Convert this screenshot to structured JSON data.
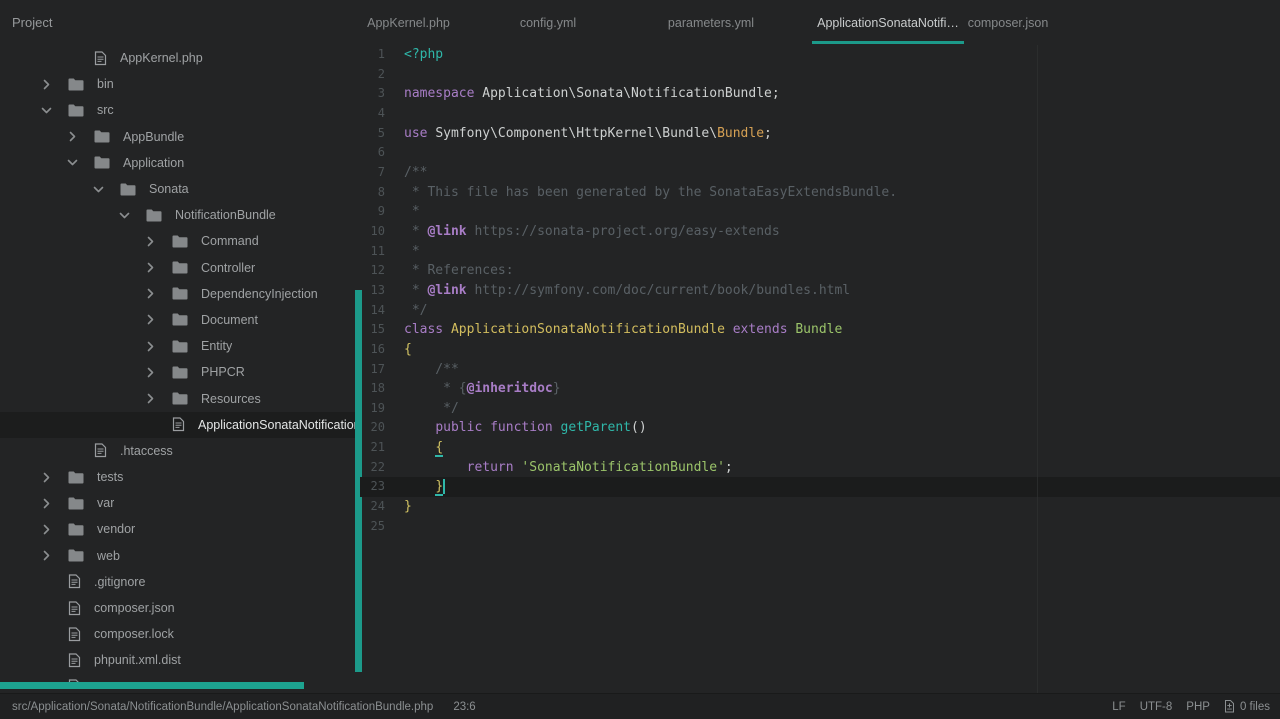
{
  "accent_color": "#1c9a8a",
  "sidebar": {
    "title": "Project"
  },
  "tabs": [
    {
      "label": "AppKernel.php",
      "active": false
    },
    {
      "label": "config.yml",
      "active": false
    },
    {
      "label": "parameters.yml",
      "active": false
    },
    {
      "label": "ApplicationSonataNotifi…",
      "active": true
    },
    {
      "label": "composer.json",
      "active": false
    }
  ],
  "tree": {
    "items": [
      {
        "kind": "file",
        "level": 1,
        "label": "AppKernel.php"
      },
      {
        "kind": "folder",
        "level": 0,
        "expanded": false,
        "label": "bin"
      },
      {
        "kind": "folder",
        "level": 0,
        "expanded": true,
        "label": "src"
      },
      {
        "kind": "folder",
        "level": 1,
        "expanded": false,
        "label": "AppBundle"
      },
      {
        "kind": "folder",
        "level": 1,
        "expanded": true,
        "label": "Application"
      },
      {
        "kind": "folder",
        "level": 2,
        "expanded": true,
        "label": "Sonata"
      },
      {
        "kind": "folder",
        "level": 3,
        "expanded": true,
        "label": "NotificationBundle"
      },
      {
        "kind": "folder",
        "level": 4,
        "expanded": false,
        "label": "Command"
      },
      {
        "kind": "folder",
        "level": 4,
        "expanded": false,
        "label": "Controller"
      },
      {
        "kind": "folder",
        "level": 4,
        "expanded": false,
        "label": "DependencyInjection"
      },
      {
        "kind": "folder",
        "level": 4,
        "expanded": false,
        "label": "Document"
      },
      {
        "kind": "folder",
        "level": 4,
        "expanded": false,
        "label": "Entity"
      },
      {
        "kind": "folder",
        "level": 4,
        "expanded": false,
        "label": "PHPCR"
      },
      {
        "kind": "folder",
        "level": 4,
        "expanded": false,
        "label": "Resources"
      },
      {
        "kind": "file",
        "level": 4,
        "label": "ApplicationSonataNotificationB",
        "selected": true
      },
      {
        "kind": "file",
        "level": 1,
        "label": ".htaccess"
      },
      {
        "kind": "folder",
        "level": 0,
        "expanded": false,
        "label": "tests"
      },
      {
        "kind": "folder",
        "level": 0,
        "expanded": false,
        "label": "var"
      },
      {
        "kind": "folder",
        "level": 0,
        "expanded": false,
        "label": "vendor"
      },
      {
        "kind": "folder",
        "level": 0,
        "expanded": false,
        "label": "web"
      },
      {
        "kind": "file",
        "level": 0,
        "label": ".gitignore"
      },
      {
        "kind": "file",
        "level": 0,
        "label": "composer.json"
      },
      {
        "kind": "file",
        "level": 0,
        "label": "composer.lock"
      },
      {
        "kind": "file",
        "level": 0,
        "label": "phpunit.xml.dist"
      },
      {
        "kind": "file",
        "level": 0,
        "label": ""
      }
    ]
  },
  "editor": {
    "cursor": {
      "line": 23,
      "col": 6
    },
    "syntax_colors": {
      "keyword": "#a87dc6",
      "php_tag": "#2fb7a9",
      "class_name": "#d2bd5e",
      "imported_class": "#d6a154",
      "string": "#9bc46a",
      "comment": "#596065",
      "doc_tag": "#a87dc6",
      "brace": "#d2c363",
      "default": "#cdd0d0"
    },
    "lines": [
      {
        "n": 1,
        "tokens": [
          [
            "t",
            "<?php"
          ]
        ]
      },
      {
        "n": 2,
        "tokens": []
      },
      {
        "n": 3,
        "tokens": [
          [
            "k",
            "namespace "
          ],
          [
            "d",
            "Application\\Sonata\\NotificationBundle;"
          ]
        ]
      },
      {
        "n": 4,
        "tokens": []
      },
      {
        "n": 5,
        "tokens": [
          [
            "k",
            "use "
          ],
          [
            "d",
            "Symfony\\Component\\HttpKernel\\Bundle\\"
          ],
          [
            "o",
            "Bundle"
          ],
          [
            "d",
            ";"
          ]
        ]
      },
      {
        "n": 6,
        "tokens": []
      },
      {
        "n": 7,
        "tokens": [
          [
            "c",
            "/**"
          ]
        ]
      },
      {
        "n": 8,
        "tokens": [
          [
            "c",
            " * This file has been generated by the SonataEasyExtendsBundle."
          ]
        ]
      },
      {
        "n": 9,
        "tokens": [
          [
            "c",
            " *"
          ]
        ]
      },
      {
        "n": 10,
        "tokens": [
          [
            "c",
            " * "
          ],
          [
            "a",
            "@link"
          ],
          [
            "c",
            " https://sonata-project.org/easy-extends"
          ]
        ]
      },
      {
        "n": 11,
        "tokens": [
          [
            "c",
            " *"
          ]
        ]
      },
      {
        "n": 12,
        "tokens": [
          [
            "c",
            " * References:"
          ]
        ]
      },
      {
        "n": 13,
        "tokens": [
          [
            "c",
            " * "
          ],
          [
            "a",
            "@link"
          ],
          [
            "c",
            " http://symfony.com/doc/current/book/bundles.html"
          ]
        ]
      },
      {
        "n": 14,
        "tokens": [
          [
            "c",
            " */"
          ]
        ]
      },
      {
        "n": 15,
        "tokens": [
          [
            "k",
            "class "
          ],
          [
            "y",
            "ApplicationSonataNotificationBundle"
          ],
          [
            "d",
            " "
          ],
          [
            "k",
            "extends"
          ],
          [
            "d",
            " "
          ],
          [
            "g",
            "Bundle"
          ]
        ]
      },
      {
        "n": 16,
        "tokens": [
          [
            "b",
            "{"
          ]
        ]
      },
      {
        "n": 17,
        "tokens": [
          [
            "c",
            "    /**"
          ]
        ]
      },
      {
        "n": 18,
        "tokens": [
          [
            "c",
            "     * {"
          ],
          [
            "a",
            "@inheritdoc"
          ],
          [
            "c",
            "}"
          ]
        ]
      },
      {
        "n": 19,
        "tokens": [
          [
            "c",
            "     */"
          ]
        ]
      },
      {
        "n": 20,
        "tokens": [
          [
            "d",
            "    "
          ],
          [
            "k",
            "public function "
          ],
          [
            "t",
            "getParent"
          ],
          [
            "d",
            "()"
          ]
        ]
      },
      {
        "n": 21,
        "tokens": [
          [
            "d",
            "    "
          ],
          [
            "bu",
            "{"
          ]
        ]
      },
      {
        "n": 22,
        "tokens": [
          [
            "d",
            "        "
          ],
          [
            "k",
            "return "
          ],
          [
            "g",
            "'SonataNotificationBundle'"
          ],
          [
            "d",
            ";"
          ]
        ]
      },
      {
        "n": 23,
        "tokens": [
          [
            "d",
            "    "
          ],
          [
            "bu",
            "}"
          ]
        ]
      },
      {
        "n": 24,
        "tokens": [
          [
            "b",
            "}"
          ]
        ]
      },
      {
        "n": 25,
        "tokens": []
      }
    ]
  },
  "status_bar": {
    "file_path": "src/Application/Sonata/NotificationBundle/ApplicationSonataNotificationBundle.php",
    "cursor_position": "23:6",
    "line_ending": "LF",
    "encoding": "UTF-8",
    "language": "PHP",
    "files_badge": "0 files"
  }
}
